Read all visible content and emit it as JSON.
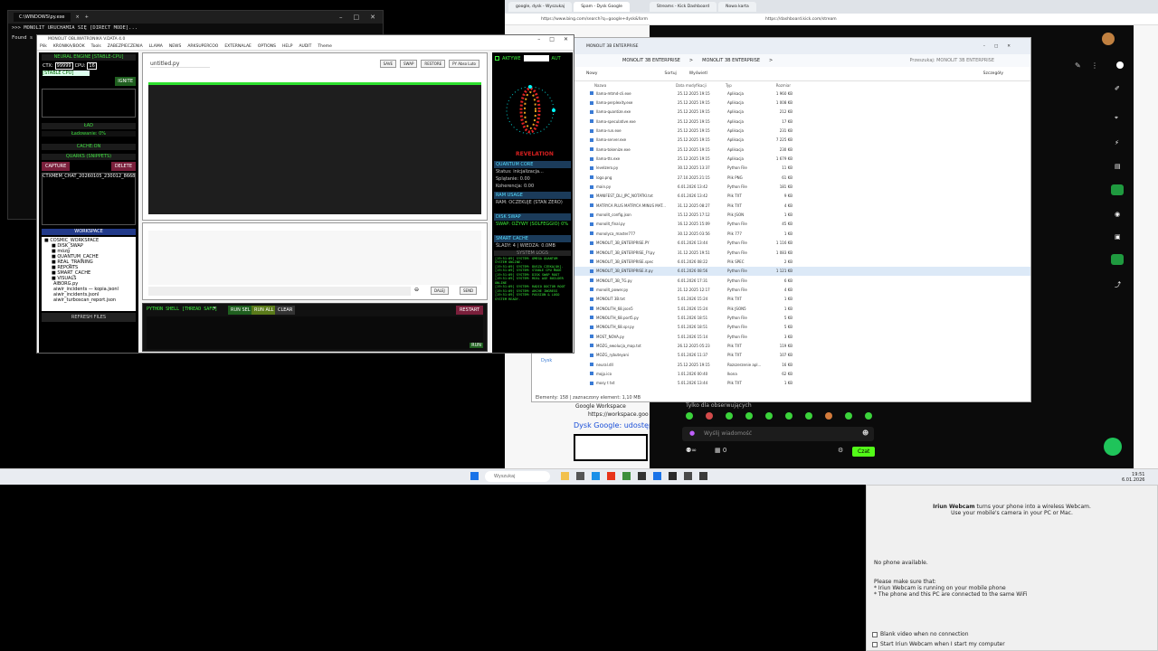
{
  "terminal": {
    "title": "C:\\WINDOWS\\py.exe",
    "lines": [
      ">>> MONOLIT URUCHAMIA SIĘ [DIRECT MODE]...",
      "Found s"
    ]
  },
  "monolit": {
    "title": "MONOLIT OBLIWATRONIKA V.DATA 4.0",
    "menu": [
      "Plik",
      "KRONIKA/BOOK",
      "Tools",
      "ZABEZPIECZENIA",
      "LLAMA",
      "NEWS",
      "ARKSUPERCOO",
      "EXTERNALAE",
      "OPTIONS",
      "HELP",
      "AUDIT",
      "Theme"
    ],
    "left": {
      "neural_engine": "NEURAL ENGINE [STABLE-CPU]",
      "ctx_label": "CTX:",
      "ctx_value": "99999",
      "cpu_label": "CPU:",
      "cpu_value": "16",
      "stable_cpu": "[STABLE CPU]",
      "ignite": "IGNITE",
      "load_label": "ŁAD",
      "loading": "Ładowanie: 0%",
      "cache_on": "CACHE:ON",
      "quarks": "QUARKS (SNIPPETS)",
      "capture": "CAPTURE",
      "delete": "DELETE",
      "snippet": "CTXMEM_CHAT_20260105_230012_8668",
      "workspace": "WORKSPACE",
      "tree": [
        "■ COSMIC_WORKSPACE",
        "■ DISK_SWAP",
        "■ mózg",
        "■ QUANTUM_CACHE",
        "■ REAL_TRAINING",
        "■ REPORTS",
        "■ SMART_CACHE",
        "■ VISUALS",
        "AIBORG.py",
        "aiwir_incidents — kopia.jsonl",
        "aiwir_incidents.jsonl",
        "aiwir_turboscan_report.json"
      ],
      "refresh": "REFRESH FILES"
    },
    "editor": {
      "filename": "untitled.py",
      "buttons": [
        "SAVE",
        "SWAP",
        "RESTORE",
        "PY Abso Luto"
      ]
    },
    "chat": {
      "dalej": "DALEJ",
      "send": "SEND"
    },
    "shell": {
      "label": "PYTHON SHELL [THREAD SAFE]",
      "run_sel": "RUN SEL",
      "run_all": "RUN ALL",
      "clear": "CLEAR",
      "restart": "RESTART",
      "run": "RUN"
    },
    "right": {
      "active": "AKTYWE",
      "auto": "AUT",
      "levitation": "REVELATION",
      "quantum_core": "QUANTUM CORE",
      "status": "Status: inicjalizacja...",
      "splatanie": "Splątanie: 0.00",
      "koherencja": "Koherencja: 0.00",
      "ram_usage": "RAM USAGE",
      "ram_status": "RAM: OCZEKUJE (STAN ZERO)",
      "disk_swap": "DISK SWAP",
      "swap_status": "SWAP: OŻYWY (SOLFEGGIO) 0%",
      "smart_cache": "SMART CACHE",
      "cache_status": "ŚLADY: 4 | WIEDZA: 0.0MB",
      "system_logs": "SYSTEM LOGS",
      "logs": [
        "[19:51:09] SYSTEM: OMEGA QUANTUM SYSTEM ONLINE.",
        "[19:51:09] SYSTEM: DUSZA CZEKA[OK].",
        "[19:51:09] SYSTEM: STABLE CPU MODE",
        "[19:51:09] SYSTEM: DISK SWAP ROOT",
        "[19:51:09] SYSTEM: REAL AGE BUILDER ONLINE",
        "[19:51:09] SYSTEM: RADIO DOCTOR ROOT",
        "[19:51:09] SYSTEM: ARCHE INGRESS",
        "[19:51:09] SYSTEM: PASSION & LOGO SYSTEM READY."
      ]
    }
  },
  "browser": {
    "tabs": [
      "google, dysk - Wyszukaj",
      "Spam - Dysk Google",
      "Streams - Kick Dashboard",
      "Nowa karta"
    ],
    "url_left": "https://www.bing.com/search?q=google+dysk&form",
    "url_right": "https://dashboard.kick.com/stream",
    "google_workspace": "Google Workspace",
    "workspace_url": "https://workspace.goo",
    "drive_share": "Dysk Google: udostęp"
  },
  "explorer": {
    "tab_title": "MONOLIT 3B ENTERPRISE",
    "breadcrumb": [
      "MONOLIT 3B ENTERPRISE",
      ">",
      "MONOLIT 3B ENTERPRISE",
      ">"
    ],
    "search_placeholder": "Przeszukaj: MONOLIT 3B ENTERPRISE",
    "toolbar": [
      "Nowy",
      "Sortuj",
      "Wyświetl",
      "Szczegóły"
    ],
    "columns": [
      "Nazwa",
      "Data modyfikacji",
      "Typ",
      "Rozmiar"
    ],
    "files": [
      {
        "name": "llama-mtmd-cli.exe",
        "date": "25.12.2025 19:15",
        "type": "Aplikacja",
        "size": "1 960 KB"
      },
      {
        "name": "llama-perplexity.exe",
        "date": "25.12.2025 19:15",
        "type": "Aplikacja",
        "size": "1 008 KB"
      },
      {
        "name": "llama-quantize.exe",
        "date": "25.12.2025 19:15",
        "type": "Aplikacja",
        "size": "212 KB"
      },
      {
        "name": "llama-speculative.exe",
        "date": "25.12.2025 19:15",
        "type": "Aplikacja",
        "size": "17 KB"
      },
      {
        "name": "llama-run.exe",
        "date": "25.12.2025 19:15",
        "type": "Aplikacja",
        "size": "231 KB"
      },
      {
        "name": "llama-server.exe",
        "date": "25.12.2025 19:15",
        "type": "Aplikacja",
        "size": "7 225 KB"
      },
      {
        "name": "llama-tokenize.exe",
        "date": "25.12.2025 19:15",
        "type": "Aplikacja",
        "size": "230 KB"
      },
      {
        "name": "llama-tts.exe",
        "date": "25.12.2025 19:15",
        "type": "Aplikacja",
        "size": "1 679 KB"
      },
      {
        "name": "levelzero.py",
        "date": "30.12.2025 13:37",
        "type": "Python File",
        "size": "11 KB"
      },
      {
        "name": "logo.png",
        "date": "27.10.2025 21:15",
        "type": "Plik PNG",
        "size": "61 KB"
      },
      {
        "name": "main.py",
        "date": "6.01.2026 13:42",
        "type": "Python File",
        "size": "181 KB"
      },
      {
        "name": "MANIFEST_DLI_JPC_NOTATKI.txt",
        "date": "6.01.2026 13:42",
        "type": "Plik TXT",
        "size": "9 KB"
      },
      {
        "name": "MATRYCA PLUS MATRYCA MINUS MAT...",
        "date": "31.12.2025 08:27",
        "type": "Plik TXT",
        "size": "4 KB"
      },
      {
        "name": "monolit_config.json",
        "date": "15.12.2025 17:12",
        "type": "Plik JSON",
        "size": "1 KB"
      },
      {
        "name": "monolit_final.py",
        "date": "16.12.2025 15:09",
        "type": "Python File",
        "size": "45 KB"
      },
      {
        "name": "monolyca_master777",
        "date": "30.12.2025 03:56",
        "type": "Plik 777",
        "size": "1 KB"
      },
      {
        "name": "MONOLIT_3B_ENTERPRISE.PY",
        "date": "6.01.2026 13:44",
        "type": "Python File",
        "size": "1 116 KB"
      },
      {
        "name": "MONOLIT_3B_ENTERPRISE_FY.py",
        "date": "31.12.2025 19:51",
        "type": "Python File",
        "size": "1 083 KB"
      },
      {
        "name": "MONOLIT_3B_ENTERPRISE.spec",
        "date": "6.01.2026 08:22",
        "type": "Plik SPEC",
        "size": "2 KB"
      },
      {
        "name": "MONOLIT_3B_ENTERPRISE.it.py",
        "date": "6.01.2026 08:56",
        "type": "Python File",
        "size": "1 121 KB"
      },
      {
        "name": "MONOLIT_3B_TG.py",
        "date": "6.01.2026 17:31",
        "type": "Python File",
        "size": "6 KB"
      },
      {
        "name": "monolit_power.py",
        "date": "21.12.2025 12:17",
        "type": "Python File",
        "size": "4 KB"
      },
      {
        "name": "MONOLIT 3B.txt",
        "date": "5.01.2026 15:24",
        "type": "Plik TXT",
        "size": "1 KB"
      },
      {
        "name": "MONOLITH_68.json5",
        "date": "5.01.2026 15:24",
        "type": "Plik JSON5",
        "size": "1 KB"
      },
      {
        "name": "MONOLITH_68.port5.py",
        "date": "5.01.2026 18:51",
        "type": "Python File",
        "size": "5 KB"
      },
      {
        "name": "MONOLITH_68.spr.py",
        "date": "5.01.2026 18:51",
        "type": "Python File",
        "size": "5 KB"
      },
      {
        "name": "MOST_NOVA.py",
        "date": "5.01.2026 15:14",
        "type": "Python File",
        "size": "3 KB"
      },
      {
        "name": "MÓZG_ewolucja_map.txt",
        "date": "26.12.2025 05:23",
        "type": "Plik TXT",
        "size": "119 KB"
      },
      {
        "name": "MOZG_rybuteyani",
        "date": "5.01.2026 11:37",
        "type": "Plik TXT",
        "size": "107 KB"
      },
      {
        "name": "neural.dll",
        "date": "25.12.2025 19:15",
        "type": "Rozszerzenie apl...",
        "size": "16 KB"
      },
      {
        "name": "mojp.ico",
        "date": "1.01.2026 00:40",
        "type": "Ikona",
        "size": "62 KB"
      },
      {
        "name": "mosy t txt",
        "date": "5.01.2026 13:44",
        "type": "Plik TXT",
        "size": "1 KB"
      }
    ],
    "status": "Elementy: 158 | zaznaczony element: 1,10 MB",
    "tree_disk": "Dysk"
  },
  "kick": {
    "viewers_label": "Tylko dla obserwujących",
    "message_placeholder": "Wyślij wiadomość",
    "chat_button": "Czat",
    "count": "0",
    "emotes": [
      "#3bd23b",
      "#d24a4a",
      "#3bd23b",
      "#3bd23b",
      "#3bd23b",
      "#3bd23b",
      "#3bd23b",
      "#3bd23b",
      "#3bd23b",
      "#d27a3b",
      "#3bd23b",
      "#3bd23b"
    ]
  },
  "taskbar": {
    "search": "Wyszukaj",
    "time": "19:51",
    "date": "6.01.2026"
  },
  "webcam": {
    "headline_bold": "Iriun Webcam",
    "headline": " turns your phone into a wireless Webcam.",
    "subline": "Use your mobile's camera in your PC or Mac.",
    "no_phone": "No phone available.",
    "make_sure": "Please make sure that:",
    "bullet1": "* Iriun Webcam is running on your mobile phone",
    "bullet2": "* The phone and this PC are connected to the same WiFi",
    "opt1": "Blank video when no connection",
    "opt2": "Start Iriun Webcam when I start my computer"
  }
}
